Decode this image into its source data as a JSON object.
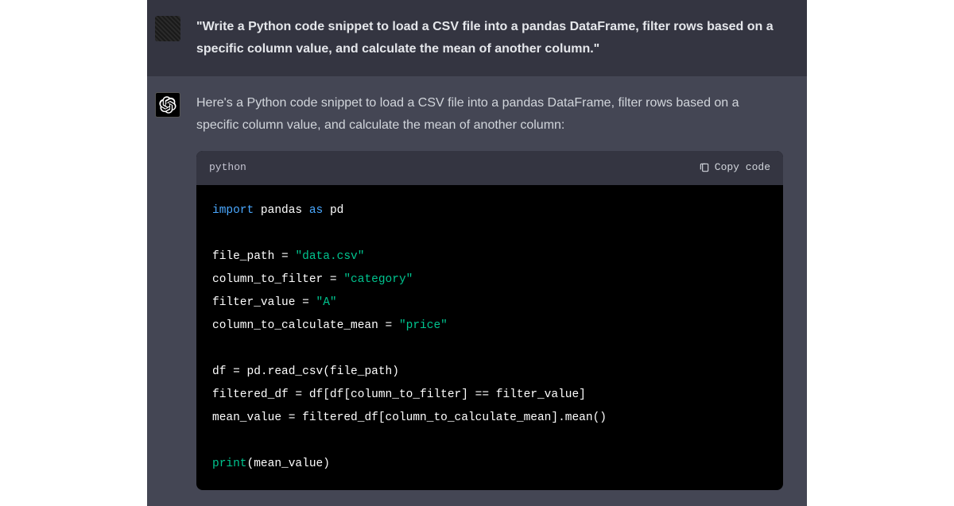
{
  "user_message": "\"Write a Python code snippet to load a CSV file into a pandas DataFrame, filter rows based on a specific column value, and calculate the mean of another column.\"",
  "assistant_intro": "Here's a Python code snippet to load a CSV file into a pandas DataFrame, filter rows based on a specific column value, and calculate the mean of another column:",
  "code_block": {
    "language": "python",
    "copy_label": "Copy code",
    "tokens": {
      "import_kw": "import",
      "pandas": "pandas",
      "as_kw": "as",
      "pd": "pd",
      "file_path_var": "file_path",
      "eq": " = ",
      "data_csv": "\"data.csv\"",
      "col_filter_var": "column_to_filter",
      "category_str": "\"category\"",
      "filter_value_var": "filter_value",
      "a_str": "\"A\"",
      "col_mean_var": "column_to_calculate_mean",
      "price_str": "\"price\"",
      "df_var": "df",
      "pd_read": "pd.read_csv(file_path)",
      "filtered_df_var": "filtered_df",
      "filter_expr": "df[df[column_to_filter] == filter_value]",
      "mean_value_var": "mean_value",
      "mean_expr": "filtered_df[column_to_calculate_mean].mean()",
      "print_fn": "print",
      "print_arg": "(mean_value)"
    }
  }
}
